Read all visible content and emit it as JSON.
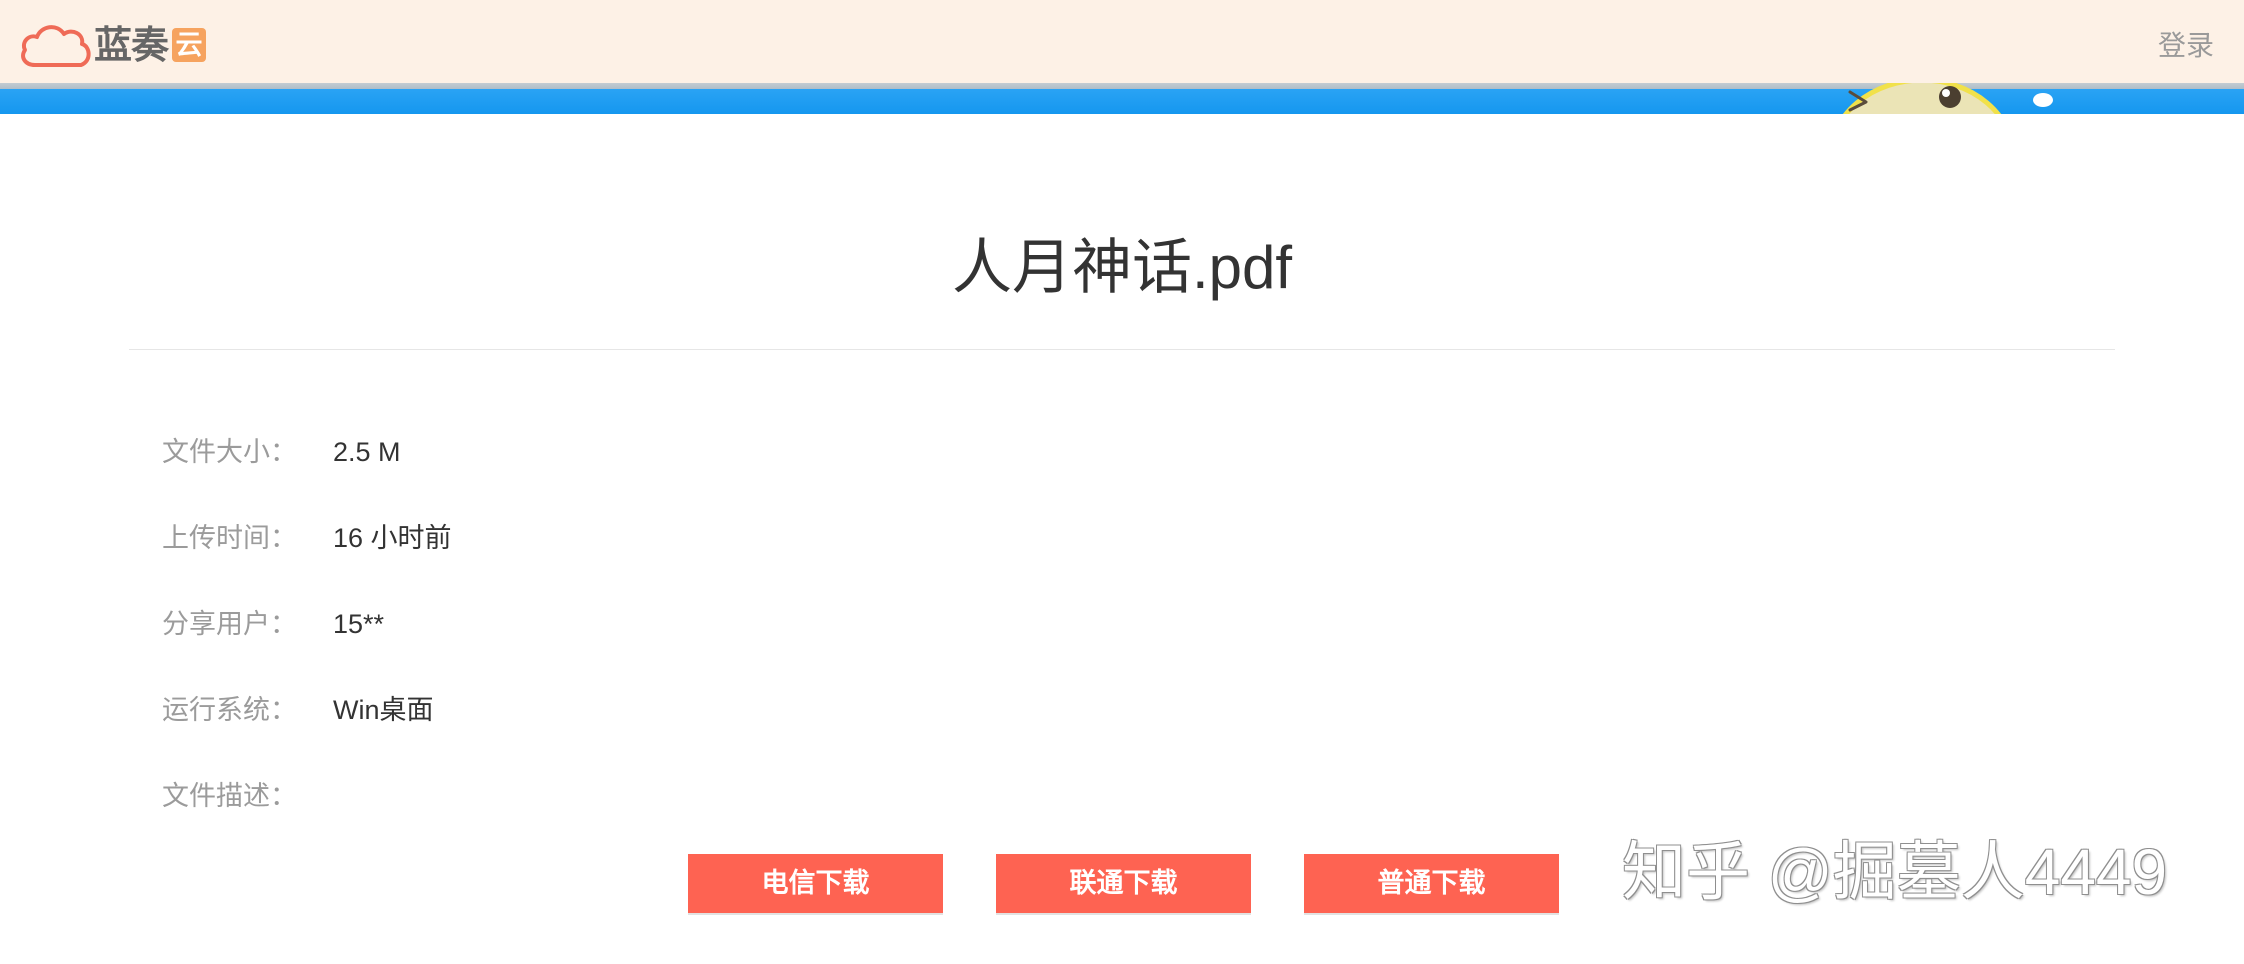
{
  "header": {
    "logo": {
      "name_text": "蓝奏",
      "badge_text": "云"
    },
    "login_label": "登录"
  },
  "file": {
    "title": "人月神话.pdf",
    "info": [
      {
        "label": "文件大小：",
        "value": "2.5 M"
      },
      {
        "label": "上传时间：",
        "value": "16 小时前"
      },
      {
        "label": "分享用户：",
        "value": "15**"
      },
      {
        "label": "运行系统：",
        "value": "Win桌面"
      },
      {
        "label": "文件描述："
      }
    ]
  },
  "downloads": [
    {
      "label": "电信下载"
    },
    {
      "label": "联通下载"
    },
    {
      "label": "普通下载"
    }
  ],
  "watermark": "知乎 @掘墓人4449",
  "icons": [
    "cloud-logo-icon",
    "mascot-graphic"
  ],
  "colors": {
    "header_bg": "#fdf1e6",
    "banner_blue": "#1b9bf1",
    "logo_accent": "#ef6b57",
    "button_bg": "#fe6352",
    "label_text": "#9b9b9b",
    "value_text": "#333333"
  }
}
